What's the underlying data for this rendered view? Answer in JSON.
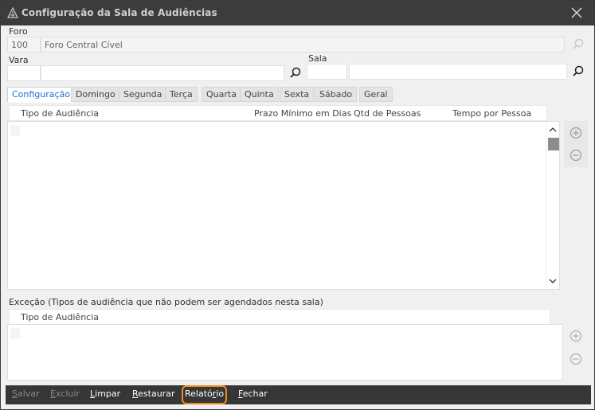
{
  "window": {
    "title": "Configuração da Sala de Audiências"
  },
  "foro": {
    "label": "Foro",
    "code": "100",
    "name": "Foro Central Cível"
  },
  "vara": {
    "label": "Vara",
    "code": "",
    "name": ""
  },
  "sala": {
    "label": "Sala",
    "code": "",
    "name": ""
  },
  "tabs": [
    {
      "label": "Configuração",
      "active": true
    },
    {
      "label": "Domingo"
    },
    {
      "label": "Segunda"
    },
    {
      "label": "Terça"
    },
    {
      "label": "Quarta"
    },
    {
      "label": "Quinta"
    },
    {
      "label": "Sexta"
    },
    {
      "label": "Sábado"
    },
    {
      "label": "Geral"
    }
  ],
  "config_table": {
    "columns": [
      "Tipo de Audiência",
      "Prazo Mínimo em Dias",
      "Qtd de Pessoas",
      "Tempo por Pessoa"
    ]
  },
  "exception": {
    "label": "Exceção (Tipos de audiência que não podem ser agendados nesta sala)",
    "columns": [
      "Tipo de Audiência"
    ]
  },
  "footer": {
    "buttons": [
      {
        "hot": "S",
        "rest": "alvar",
        "enabled": false
      },
      {
        "hot": "E",
        "rest": "xcluir",
        "enabled": false
      },
      {
        "hot": "L",
        "rest": "impar",
        "enabled": true
      },
      {
        "hot": "R",
        "rest": "estaurar",
        "enabled": true
      },
      {
        "pre": "Relató",
        "hot": "r",
        "rest": "io",
        "enabled": true,
        "highlight": true
      },
      {
        "hot": "F",
        "rest": "echar",
        "enabled": true
      }
    ]
  },
  "colors": {
    "titlebar": "#3c3c3c",
    "active_tab_text": "#1d6fd1",
    "footer": "#363636",
    "highlight_outline": "#f08a1c"
  }
}
